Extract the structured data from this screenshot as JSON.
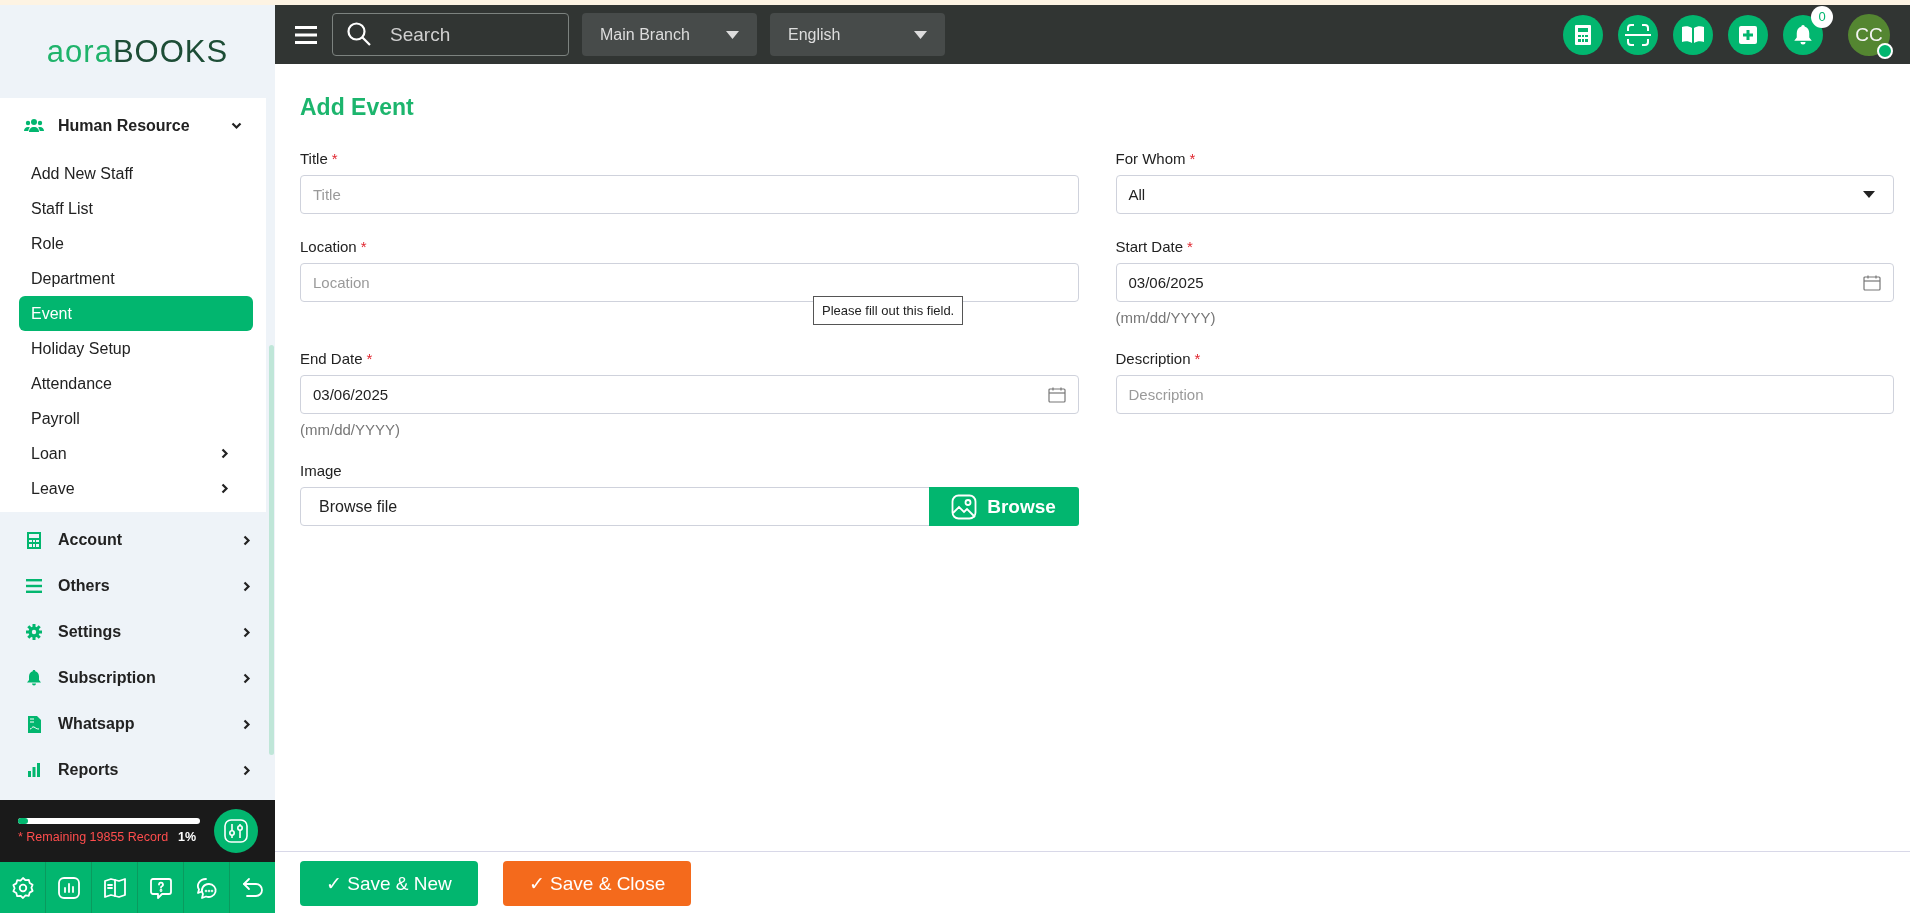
{
  "logo": {
    "prefix": "aora",
    "suffix": "BOOKS"
  },
  "sidebar": {
    "items": [
      {
        "label": "Human Resource",
        "expanded": true,
        "children": [
          {
            "label": "Add New Staff",
            "selected": false,
            "has_children": false
          },
          {
            "label": "Staff List",
            "selected": false,
            "has_children": false
          },
          {
            "label": "Role",
            "selected": false,
            "has_children": false
          },
          {
            "label": "Department",
            "selected": false,
            "has_children": false
          },
          {
            "label": "Event",
            "selected": true,
            "has_children": false
          },
          {
            "label": "Holiday Setup",
            "selected": false,
            "has_children": false
          },
          {
            "label": "Attendance",
            "selected": false,
            "has_children": false
          },
          {
            "label": "Payroll",
            "selected": false,
            "has_children": false
          },
          {
            "label": "Loan",
            "selected": false,
            "has_children": true
          },
          {
            "label": "Leave",
            "selected": false,
            "has_children": true
          }
        ]
      },
      {
        "label": "Account",
        "expanded": false
      },
      {
        "label": "Others",
        "expanded": false
      },
      {
        "label": "Settings",
        "expanded": false
      },
      {
        "label": "Subscription",
        "expanded": false
      },
      {
        "label": "Whatsapp",
        "expanded": false
      },
      {
        "label": "Reports",
        "expanded": false
      }
    ]
  },
  "usage": {
    "level": 0.01,
    "text": "* Remaining 19855 Record",
    "percent": "1%"
  },
  "topbar": {
    "search": {
      "placeholder": "Search"
    },
    "branch": "Main Branch",
    "language": "English",
    "notifications": "0",
    "avatar": "CC",
    "online": true
  },
  "page": {
    "title": "Add Event",
    "fields": [
      {
        "kind": "text",
        "label": "Title",
        "required_mark": "*",
        "placeholder": "Title"
      },
      {
        "kind": "select",
        "label": "For Whom",
        "required_mark": "*",
        "value": "All"
      },
      {
        "kind": "text",
        "label": "Location",
        "required_mark": "*",
        "placeholder": "Location",
        "error": "Please fill out this field."
      },
      {
        "kind": "date",
        "label": "Start Date",
        "required_mark": "*",
        "value": "03/06/2025",
        "hint": "(mm/dd/YYYY)"
      },
      {
        "kind": "date",
        "label": "End Date",
        "required_mark": "*",
        "value": "03/06/2025",
        "hint": "(mm/dd/YYYY)"
      },
      {
        "kind": "text",
        "label": "Description",
        "required_mark": "*",
        "placeholder": "Description"
      },
      {
        "kind": "file",
        "label": "Image",
        "value": "Browse file",
        "button": "Browse"
      }
    ]
  },
  "buttons": [
    {
      "kind": "primary",
      "label": "✓ Save & New"
    },
    {
      "kind": "secondary",
      "label": "✓ Save & Close"
    }
  ]
}
